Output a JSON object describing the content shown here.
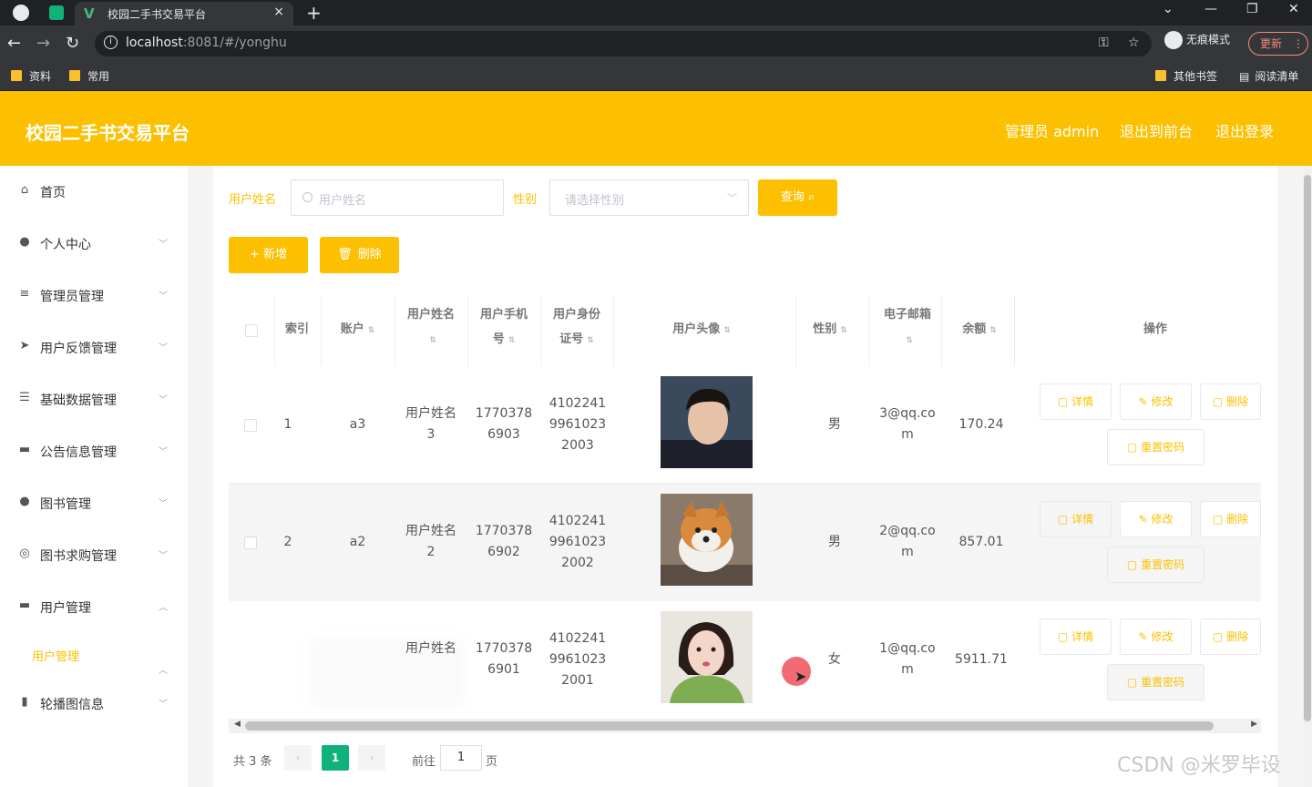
{
  "browser": {
    "tab_title": "校园二手书交易平台",
    "tab_close": "×",
    "new_tab": "+",
    "url_host": "localhost",
    "url_rest": ":8081/#/yonghu",
    "incognito_label": "无痕模式",
    "update_label": "更新",
    "bookmarks": [
      "资料",
      "常用"
    ],
    "other_bookmarks": "其他书签",
    "reading_list": "阅读清单"
  },
  "header": {
    "title": "校园二手书交易平台",
    "links": [
      "管理员 admin",
      "退出到前台",
      "退出登录"
    ]
  },
  "sidebar": {
    "items": [
      {
        "label": "首页",
        "icon": "home-icon",
        "glyph": "⌂"
      },
      {
        "label": "个人中心",
        "icon": "user-icon",
        "glyph": "●"
      },
      {
        "label": "管理员管理",
        "icon": "list-icon",
        "glyph": "≡"
      },
      {
        "label": "用户反馈管理",
        "icon": "send-icon",
        "glyph": "➤"
      },
      {
        "label": "基础数据管理",
        "icon": "sliders-icon",
        "glyph": "☰"
      },
      {
        "label": "公告信息管理",
        "icon": "monitor-icon",
        "glyph": "▬"
      },
      {
        "label": "图书管理",
        "icon": "user-icon",
        "glyph": "●"
      },
      {
        "label": "图书求购管理",
        "icon": "target-icon",
        "glyph": "◎"
      },
      {
        "label": "用户管理",
        "icon": "monitor-icon",
        "glyph": "▬"
      },
      {
        "label": "轮播图信息",
        "icon": "chart-icon",
        "glyph": "▮"
      }
    ],
    "submenu_label": "用户管理"
  },
  "search": {
    "name_label": "用户姓名",
    "name_placeholder": "用户姓名",
    "gender_label": "性别",
    "gender_placeholder": "请选择性别",
    "query_label": "查询"
  },
  "actions": {
    "add_label": "+ 新增",
    "delete_label": "删除"
  },
  "table": {
    "headers": [
      "索引",
      "账户",
      "用户姓名",
      "用户手机号",
      "用户身份证号",
      "用户头像",
      "性别",
      "电子邮箱",
      "余额",
      "操作"
    ],
    "rows": [
      {
        "index": "1",
        "account": "a3",
        "name": "用户姓名3",
        "phone": "17703786903",
        "idcard": "410224199610232003",
        "gender": "男",
        "email": "3@qq.com",
        "balance": "170.24"
      },
      {
        "index": "2",
        "account": "a2",
        "name": "用户姓名2",
        "phone": "17703786902",
        "idcard": "410224199610232002",
        "gender": "男",
        "email": "2@qq.com",
        "balance": "857.01"
      },
      {
        "index": "",
        "account": "",
        "name": "用户姓名",
        "phone": "17703786901",
        "idcard": "410224199610232001",
        "gender": "女",
        "email": "1@qq.com",
        "balance": "5911.71"
      }
    ],
    "op_labels": {
      "detail": "详情",
      "edit": "修改",
      "delete": "删除",
      "reset": "重置密码"
    }
  },
  "pager": {
    "total": "共 3 条",
    "page": "1",
    "goto": "前往",
    "goto_value": "1",
    "page_unit": "页"
  },
  "watermark": "CSDN @米罗毕设",
  "colors": {
    "accent": "#fcc000",
    "pager_active": "#0fb37a"
  }
}
